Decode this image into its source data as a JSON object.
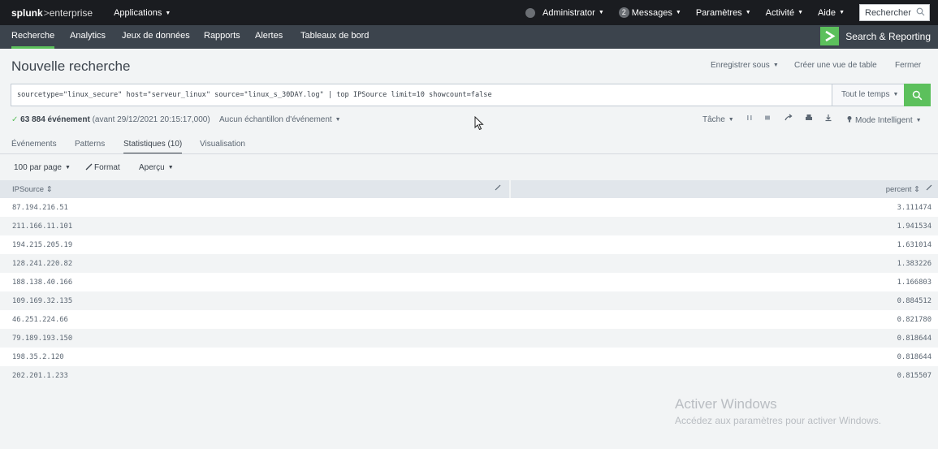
{
  "topbar": {
    "brand_splunk": "splunk",
    "brand_sep": ">",
    "brand_product": "enterprise",
    "apps_label": "Applications",
    "user_label": "Administrator",
    "messages_count": "2",
    "messages_label": "Messages",
    "settings_label": "Paramètres",
    "activity_label": "Activité",
    "help_label": "Aide",
    "search_label": "Rechercher"
  },
  "appbar": {
    "nav": [
      "Recherche",
      "Analytics",
      "Jeux de données",
      "Rapports",
      "Alertes",
      "Tableaux de bord"
    ],
    "active_index": 0,
    "app_title": "Search & Reporting",
    "accent_color": "#5cc05c"
  },
  "header": {
    "title": "Nouvelle recherche",
    "save_as": "Enregistrer sous",
    "create_table": "Créer une vue de table",
    "close": "Fermer"
  },
  "search": {
    "query": "sourcetype=\"linux_secure\" host=\"serveur_linux\"  source=\"linux_s_30DAY.log\" | top IPSource limit=10 showcount=false",
    "time_range": "Tout le temps"
  },
  "status": {
    "check": "✓",
    "events": "63 884 événement",
    "before": "(avant 29/12/2021 20:15:17,000)",
    "sampling": "Aucun échantillon d'événement",
    "job": "Tâche",
    "mode": "Mode Intelligent"
  },
  "tabs": [
    "Événements",
    "Patterns",
    "Statistiques (10)",
    "Visualisation"
  ],
  "controls": {
    "per_page": "100 par page",
    "format": "Format",
    "preview": "Aperçu"
  },
  "table": {
    "columns": [
      "IPSource",
      "percent"
    ],
    "rows": [
      {
        "ip": "87.194.216.51",
        "percent": "3.111474"
      },
      {
        "ip": "211.166.11.101",
        "percent": "1.941534"
      },
      {
        "ip": "194.215.205.19",
        "percent": "1.631014"
      },
      {
        "ip": "128.241.220.82",
        "percent": "1.383226"
      },
      {
        "ip": "188.138.40.166",
        "percent": "1.166803"
      },
      {
        "ip": "109.169.32.135",
        "percent": "0.884512"
      },
      {
        "ip": "46.251.224.66",
        "percent": "0.821780"
      },
      {
        "ip": "79.189.193.150",
        "percent": "0.818644"
      },
      {
        "ip": "198.35.2.120",
        "percent": "0.818644"
      },
      {
        "ip": "202.201.1.233",
        "percent": "0.815507"
      }
    ]
  },
  "watermark": {
    "line1": "Activer Windows",
    "line2": "Accédez aux paramètres pour activer Windows."
  }
}
